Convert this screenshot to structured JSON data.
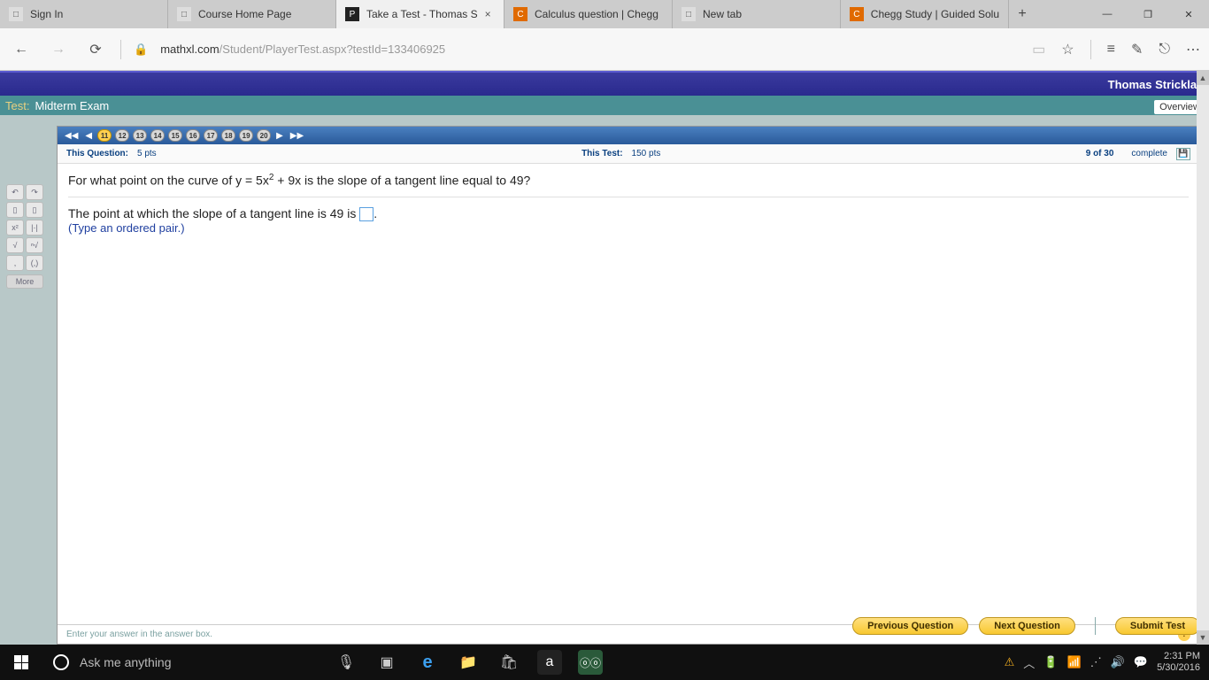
{
  "browser": {
    "tabs": [
      {
        "title": "Sign In",
        "favicon": "□"
      },
      {
        "title": "Course Home Page",
        "favicon": "□"
      },
      {
        "title": "Take a Test - Thomas S",
        "favicon": "P",
        "active": true
      },
      {
        "title": "Calculus question | Chegg",
        "favicon": "C"
      },
      {
        "title": "New tab",
        "favicon": "□"
      },
      {
        "title": "Chegg Study | Guided Solu",
        "favicon": "C"
      }
    ],
    "url_host": "mathxl.com",
    "url_path": "/Student/PlayerTest.aspx?testId=133406925"
  },
  "header": {
    "user": "Thomas Stricklan",
    "test_label": "Test:",
    "test_name": "Midterm Exam",
    "overview": "Overview"
  },
  "qnav": {
    "numbers": [
      "11",
      "12",
      "13",
      "14",
      "15",
      "16",
      "17",
      "18",
      "19",
      "20"
    ],
    "current": "11"
  },
  "info": {
    "this_q_label": "This Question:",
    "this_q_pts": "5 pts",
    "this_test_label": "This Test:",
    "this_test_pts": "150 pts",
    "progress": "9 of 30",
    "complete": "complete"
  },
  "question": {
    "prompt_pre": "For what point on the curve of y = 5x",
    "prompt_exp": "2",
    "prompt_post": " + 9x is the slope of a tangent line equal to 49?",
    "answer_line_pre": "The point at which the slope of a tangent line is 49 is ",
    "answer_line_post": ".",
    "hint": "(Type an ordered pair.)"
  },
  "footer": {
    "hint_text": "Enter your answer in the answer box."
  },
  "actions": {
    "prev": "Previous Question",
    "next": "Next Question",
    "submit": "Submit Test"
  },
  "palette": {
    "more": "More"
  },
  "taskbar": {
    "cortana": "Ask me anything",
    "time": "2:31 PM",
    "date": "5/30/2016"
  }
}
